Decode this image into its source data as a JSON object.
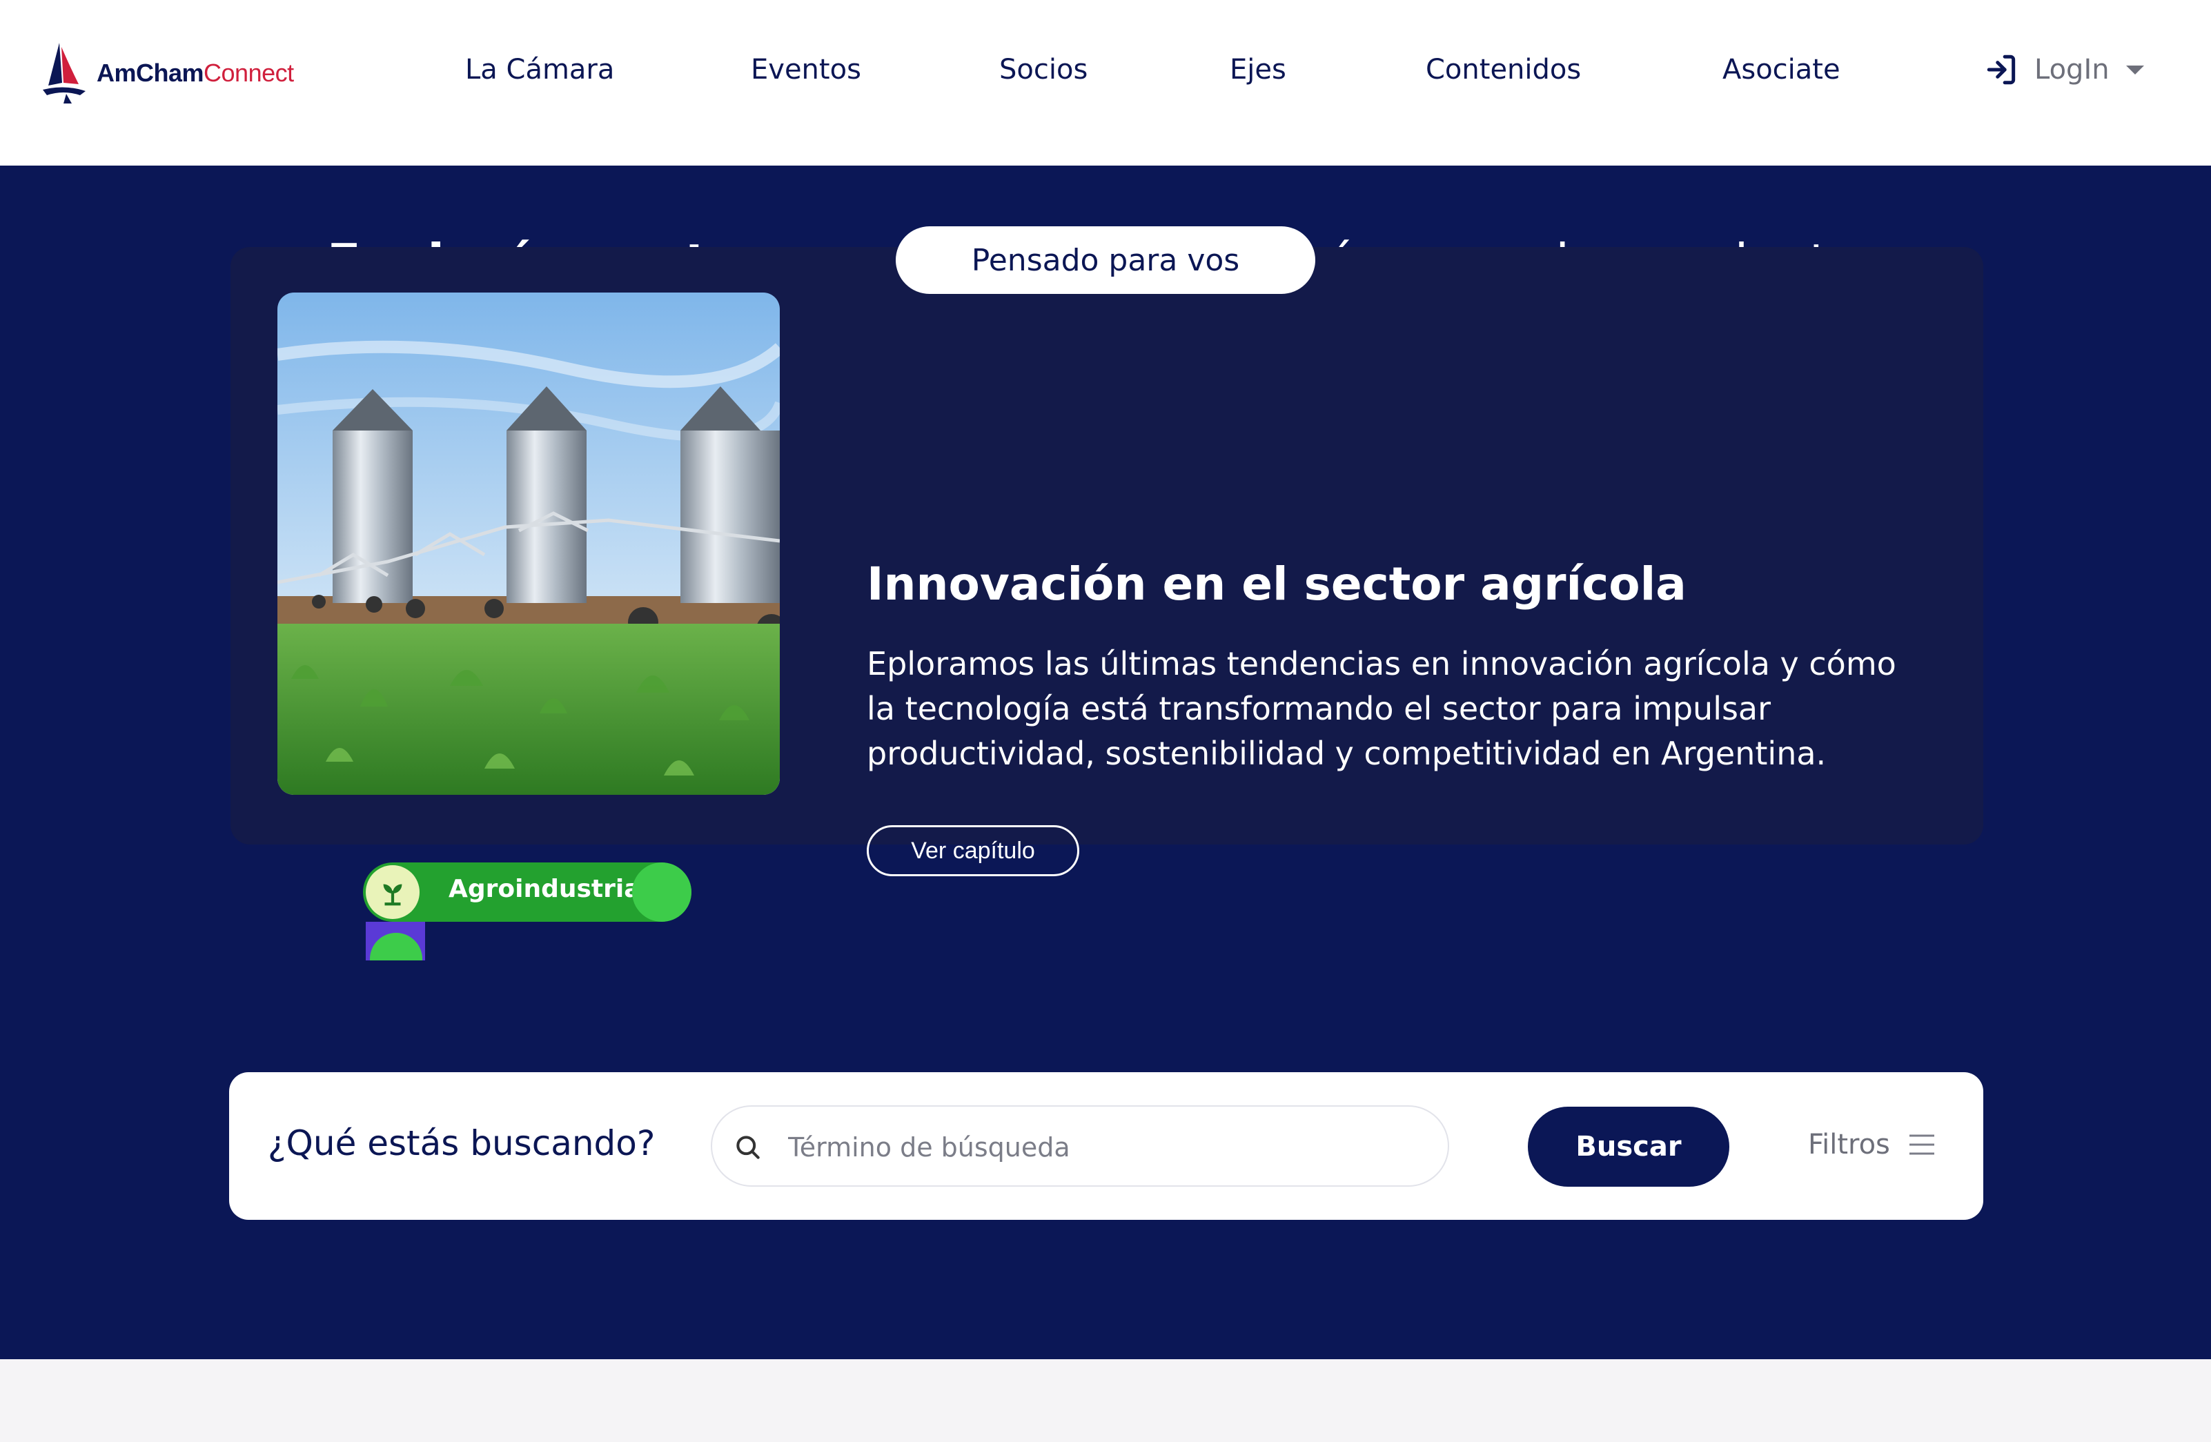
{
  "brand": {
    "name_part1": "AmCham",
    "name_part2": "Connect",
    "logo_icon": "sailboat-logo"
  },
  "nav": {
    "items": [
      {
        "label": "La Cámara"
      },
      {
        "label": "Eventos"
      },
      {
        "label": "Socios"
      },
      {
        "label": "Ejes"
      },
      {
        "label": "Contenidos"
      },
      {
        "label": "Asociate"
      }
    ],
    "login_label": "LogIn",
    "login_icon": "login-arrow-icon",
    "login_caret_icon": "caret-down-icon"
  },
  "hero": {
    "title_bold": "Explorá nuestros contenidos",
    "title_regular": " y adquirí nuevas herramientas"
  },
  "featured": {
    "pill_label": "Pensado para vos",
    "image_subject": "grain silos and irrigation pivot over green crop field",
    "tag_label": "Agroindustria",
    "tag_icon": "sprout-icon",
    "title": "Innovación en el sector agrícola",
    "description": "Eploramos las últimas tendencias en innovación agrícola y cómo la tecnología está transformando el sector para impulsar productividad, sostenibilidad y competitividad en Argentina.",
    "button_label": "Ver capítulo"
  },
  "search": {
    "question": "¿Qué estás buscando?",
    "placeholder": "Término de búsqueda",
    "button_label": "Buscar",
    "filters_label": "Filtros",
    "search_icon": "search-icon",
    "filters_icon": "menu-lines-icon"
  },
  "colors": {
    "navy": "#0b1756",
    "card_bg": "#131a4a",
    "brand_red": "#d01f3c",
    "tag_green": "#23a12f",
    "page_bg": "#f5f4f6"
  }
}
